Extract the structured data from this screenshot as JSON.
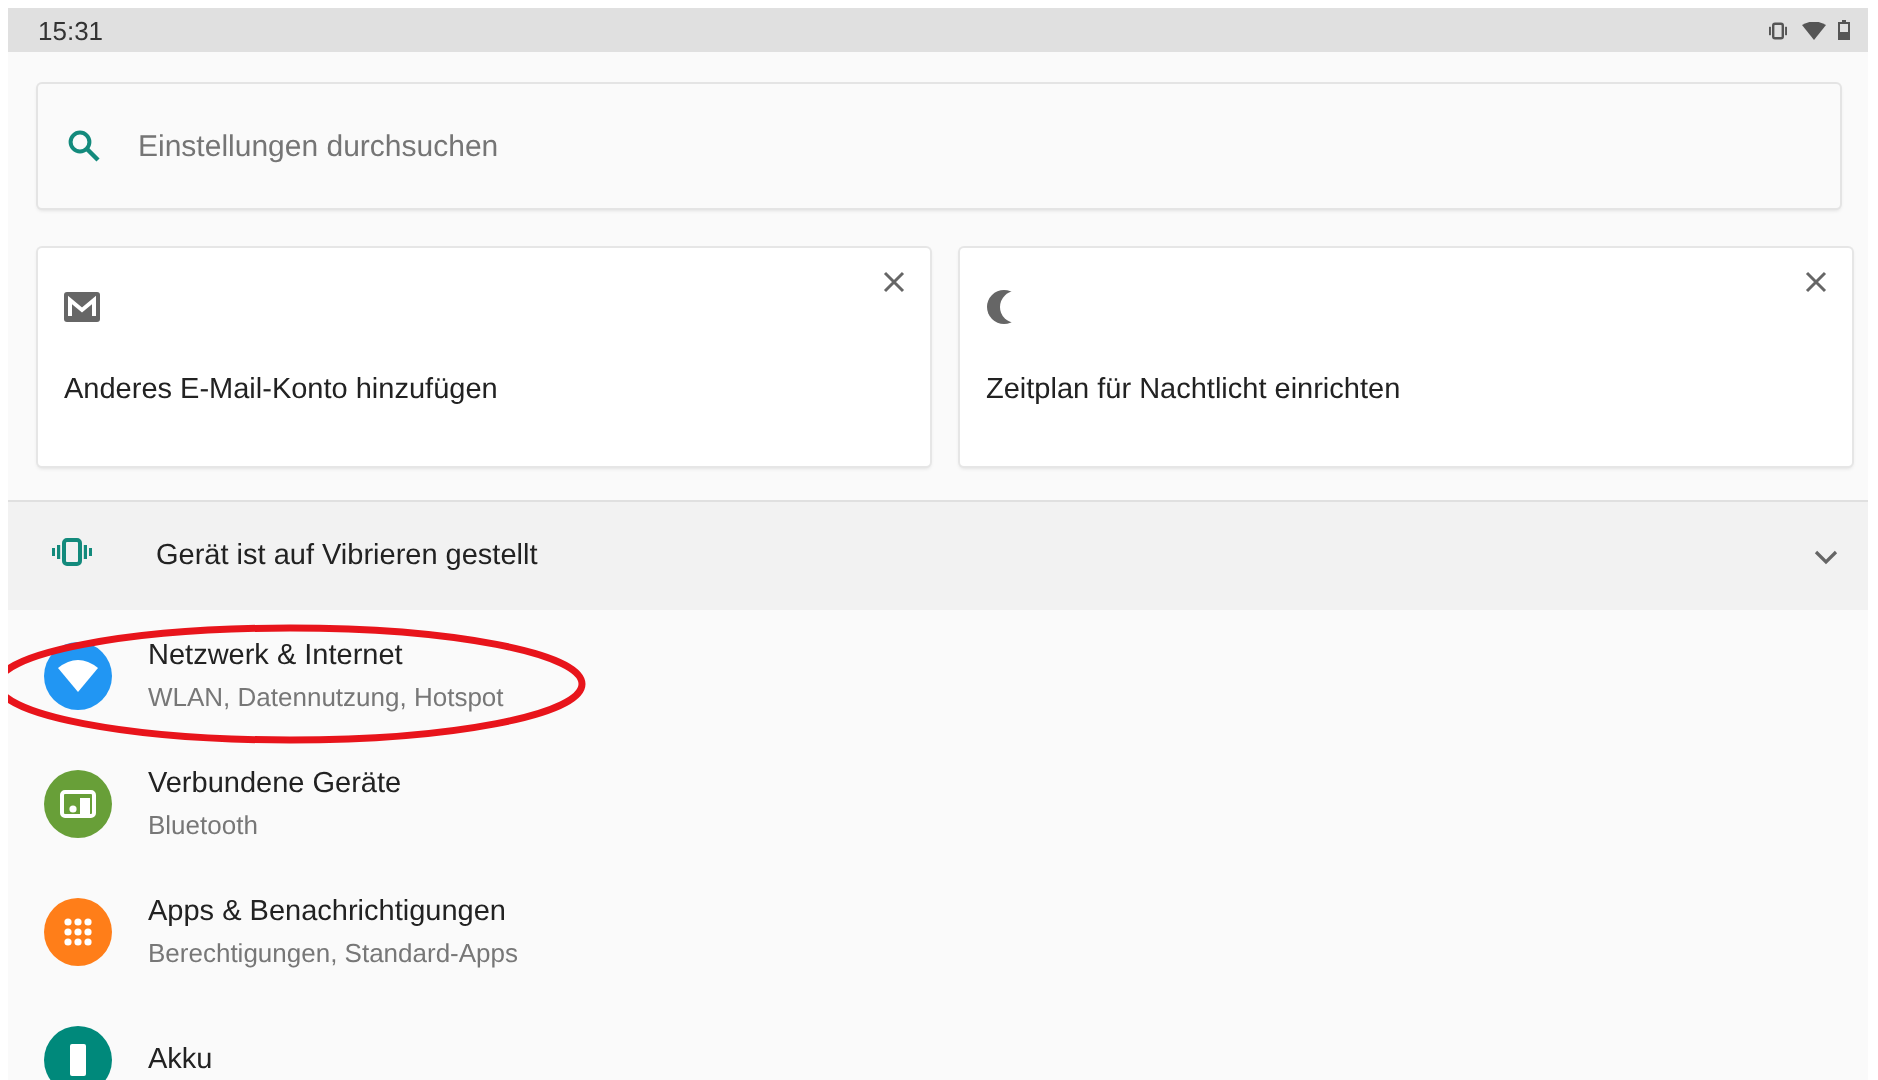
{
  "status_bar": {
    "time": "15:31"
  },
  "search": {
    "placeholder": "Einstellungen durchsuchen"
  },
  "suggestions": [
    {
      "kind": "mail",
      "title": "Anderes E-Mail-Konto hinzufügen"
    },
    {
      "kind": "night",
      "title": "Zeitplan für Nachtlicht einrichten"
    }
  ],
  "condition": {
    "kind": "vibrate",
    "title": "Gerät ist auf Vibrieren gestellt",
    "expanded": false
  },
  "items": [
    {
      "kind": "network",
      "title": "Netzwerk & Internet",
      "summary": "WLAN, Datennutzung, Hotspot",
      "color": "#2196f3",
      "circled": true
    },
    {
      "kind": "devices",
      "title": "Verbundene Geräte",
      "summary": "Bluetooth",
      "color": "#689f38",
      "circled": false
    },
    {
      "kind": "apps",
      "title": "Apps & Benachrichtigungen",
      "summary": "Berechtigungen, Standard-Apps",
      "color": "#ff7e19",
      "circled": false
    },
    {
      "kind": "battery",
      "title": "Akku",
      "color": "#00897b",
      "circled": false
    }
  ]
}
